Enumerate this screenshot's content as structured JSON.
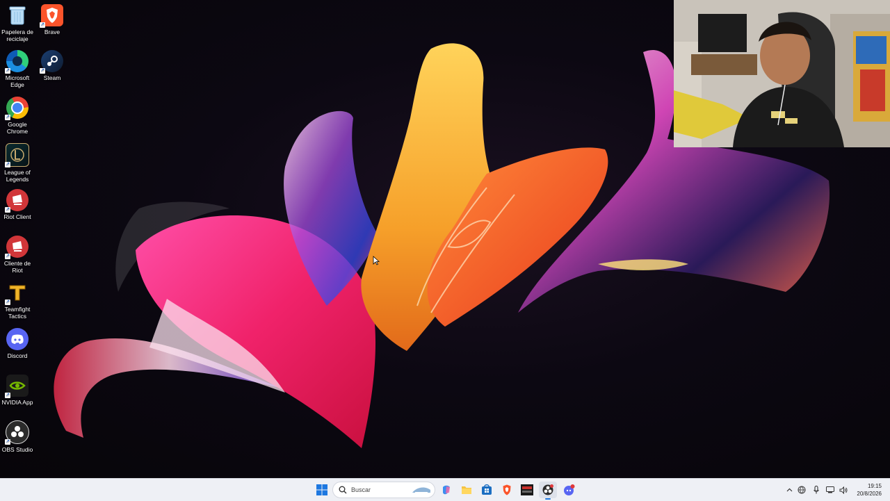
{
  "desktop": {
    "icons": [
      {
        "label": "Papelera de reciclaje",
        "icon": "recycle-bin-icon"
      },
      {
        "label": "Brave",
        "icon": "brave-icon"
      },
      {
        "label": "Microsoft Edge",
        "icon": "edge-icon"
      },
      {
        "label": "Steam",
        "icon": "steam-icon"
      },
      {
        "label": "Google Chrome",
        "icon": "chrome-icon"
      },
      {
        "label": "League of Legends",
        "icon": "league-of-legends-icon"
      },
      {
        "label": "Riot Client",
        "icon": "riot-client-icon"
      },
      {
        "label": "Cliente de Riot",
        "icon": "riot-client-icon"
      },
      {
        "label": "Teamfight Tactics",
        "icon": "teamfight-tactics-icon"
      },
      {
        "label": "Discord",
        "icon": "discord-icon"
      },
      {
        "label": "NVIDIA App",
        "icon": "nvidia-icon"
      },
      {
        "label": "OBS Studio",
        "icon": "obs-icon"
      }
    ]
  },
  "taskbar": {
    "search_placeholder": "Buscar",
    "pinned": [
      "start-icon",
      "search-icon",
      "copilot-icon",
      "file-explorer-icon",
      "microsoft-store-icon",
      "brave-icon",
      "voice-app-icon",
      "obs-icon",
      "discord-icon"
    ],
    "tray": [
      "chevron-up-icon",
      "network-icon",
      "microphone-icon",
      "battery-icon",
      "volume-icon"
    ],
    "time": "19:15",
    "date": "20/8/2026"
  },
  "colors": {
    "accent": "#2a6bd8",
    "taskbar_bg": "#eef0f5"
  }
}
